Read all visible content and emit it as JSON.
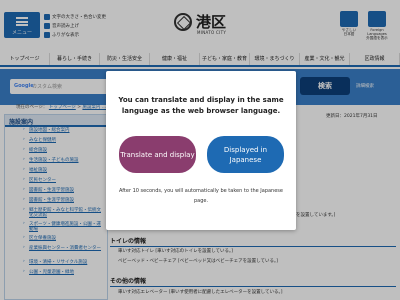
{
  "header": {
    "menu_label": "メニュー",
    "utilities": [
      "文字の大きさ・色合い変更",
      "音声読み上げ",
      "ふりがな表示"
    ],
    "logo_name": "港区",
    "logo_sub": "MINATO CITY",
    "icon_one": [
      "やさしい",
      "日本語"
    ],
    "icon_two": [
      "Foreign",
      "Languages",
      "外国語を表示"
    ]
  },
  "nav": [
    "トップページ",
    "暮らし・手続き",
    "防災・生活安全",
    "健康・福祉",
    "子ども・家庭・教育",
    "環境・まちづくり",
    "産業・文化・観光",
    "区政情報"
  ],
  "search": {
    "google": "Google",
    "placeholder": "カスタム検索",
    "button": "検索",
    "detail": "詳細検索"
  },
  "breadcrumb": {
    "current_label": "現在のページ：",
    "top": "トップページ",
    "rest": "施設案内 ..."
  },
  "sidebar": {
    "title": "施設案内",
    "items": [
      "施設地図・総合案内",
      "みなと保健所",
      "総合施設",
      "生活施設・子どもの施設",
      "福祉施設",
      "区民センター",
      "図書館・生涯学習施設",
      "図書館・生涯学習施設",
      "郷土歴史館・みなと科学館・伝統文化交流館",
      "スポーツ・健康増進施設・公園・運動場",
      "区立保養施設",
      "産業振興センター・消費者センター",
      "環境・清掃・リサイクル施設",
      "公園・児童遊園・緑地"
    ]
  },
  "content": {
    "update": "更新日：2021年7月31日",
    "partial": "を設置しています。]",
    "toilet_title": "トイレの情報",
    "toilet_items": [
      "車いす対応トイレ [車いす対応のトイレを設置している。]",
      "ベビーベッド・ベビーチェア [ベビーベッド又はベビーチェアを設置している。]"
    ],
    "other_title": "その他の情報",
    "other_items": [
      "車いす対応エレベーター [車いす使用者に配慮したエレベーターを設置している。]"
    ]
  },
  "modal": {
    "message": "You can translate and display in the same language as the web browser language.",
    "translate_label": "Translate and display",
    "japanese_label": "Displayed in Japanese",
    "note": "After 10 seconds, you will automatically be taken to the Japanese page."
  },
  "colors": {
    "brand_blue": "#1e6ab3",
    "search_band": "#3a7fc8",
    "search_button": "#0d3f7a",
    "translate_button": "#8a3d6e"
  }
}
